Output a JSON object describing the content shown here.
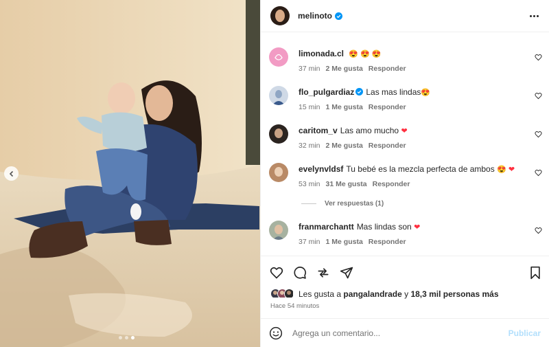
{
  "post": {
    "username": "melinoto",
    "verified": true,
    "carousel": {
      "total": 3,
      "current": 3
    }
  },
  "comments": [
    {
      "user": "limonada.cl",
      "verified": false,
      "text": "",
      "emojis": "😍 😍 😍",
      "time": "37 min",
      "likes": "2 Me gusta",
      "reply": "Responder",
      "avatar_color": "#f29bc4"
    },
    {
      "user": "flo_pulgardiaz",
      "verified": true,
      "text": "Las mas lindas",
      "emojis": "😍",
      "time": "15 min",
      "likes": "1 Me gusta",
      "reply": "Responder",
      "avatar_color": "#cfd9e6"
    },
    {
      "user": "caritom_v",
      "verified": false,
      "text": "Las amo mucho",
      "emojis": "❤",
      "time": "32 min",
      "likes": "2 Me gusta",
      "reply": "Responder",
      "avatar_color": "#2b2420"
    },
    {
      "user": "evelynvldsf",
      "verified": false,
      "text": "Tu bebé es la mezcla perfecta de ambos",
      "emojis": "😍 ❤",
      "time": "53 min",
      "likes": "31 Me gusta",
      "reply": "Responder",
      "avatar_color": "#b98a66"
    },
    {
      "user": "franmarchantt",
      "verified": false,
      "text": "Mas lindas son",
      "emojis": "❤",
      "time": "37 min",
      "likes": "1 Me gusta",
      "reply": "Responder",
      "avatar_color": "#a7b2a0"
    }
  ],
  "view_replies": "Ver respuestas (1)",
  "likes_summary": {
    "prefix": "Les gusta a",
    "user": "pangalandrade",
    "middle": "y",
    "rest": "18,3 mil personas más"
  },
  "posted_ago": "Hace 54 minutos",
  "composer": {
    "placeholder": "Agrega un comentario...",
    "publish": "Publicar"
  },
  "colors": {
    "verified_blue": "#0095f6",
    "publish_disabled": "#b2dffc",
    "heart_red": "#ff3040"
  },
  "icons": [
    "chevron-left-icon",
    "verified-icon",
    "more-icon",
    "heart-icon",
    "comment-icon",
    "share-icon",
    "send-icon",
    "bookmark-icon",
    "emoji-icon"
  ]
}
